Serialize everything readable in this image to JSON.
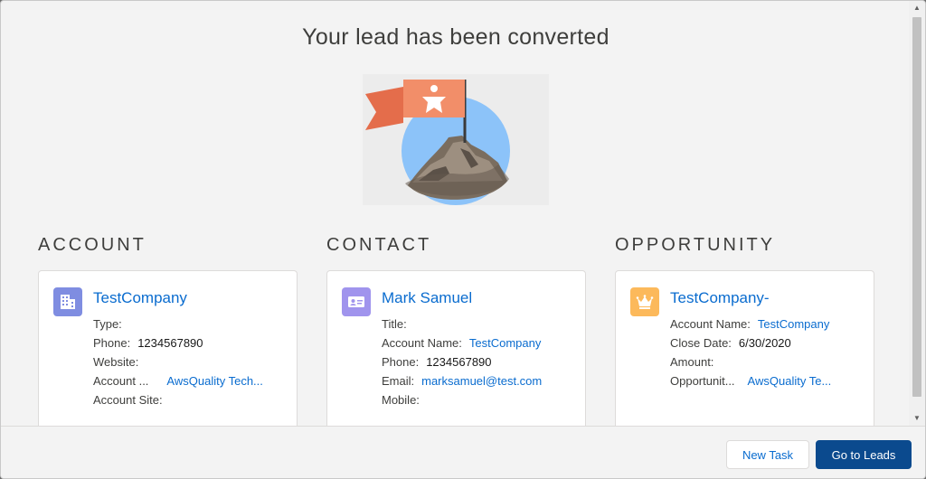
{
  "modal": {
    "title": "Your lead has been converted"
  },
  "colors": {
    "link": "#0a6ccf",
    "account_icon_bg": "#7f8de1",
    "contact_icon_bg": "#a094ed",
    "opportunity_icon_bg": "#fcb95b",
    "brand_button_bg": "#0b4a8e"
  },
  "account": {
    "section_label": "ACCOUNT",
    "icon": "account-building-icon",
    "name": "TestCompany",
    "fields": [
      {
        "label": "Type:",
        "value": ""
      },
      {
        "label": "Phone:",
        "value": "1234567890"
      },
      {
        "label": "Website:",
        "value": ""
      },
      {
        "label": "Account ...",
        "value": "AwsQuality Tech..."
      },
      {
        "label": "Account Site:",
        "value": ""
      }
    ]
  },
  "contact": {
    "section_label": "CONTACT",
    "icon": "contact-card-icon",
    "name": "Mark Samuel",
    "fields": [
      {
        "label": "Title:",
        "value": ""
      },
      {
        "label": "Account Name:",
        "value": "TestCompany"
      },
      {
        "label": "Phone:",
        "value": "1234567890"
      },
      {
        "label": "Email:",
        "value": "marksamuel@test.com"
      },
      {
        "label": "Mobile:",
        "value": ""
      }
    ]
  },
  "opportunity": {
    "section_label": "OPPORTUNITY",
    "icon": "opportunity-crown-icon",
    "name": "TestCompany-",
    "fields": [
      {
        "label": "Account Name:",
        "value": "TestCompany"
      },
      {
        "label": "Close Date:",
        "value": "6/30/2020"
      },
      {
        "label": "Amount:",
        "value": ""
      },
      {
        "label": "Opportunit...",
        "value": "AwsQuality Te..."
      }
    ]
  },
  "footer": {
    "new_task_label": "New Task",
    "go_to_leads_label": "Go to Leads"
  }
}
